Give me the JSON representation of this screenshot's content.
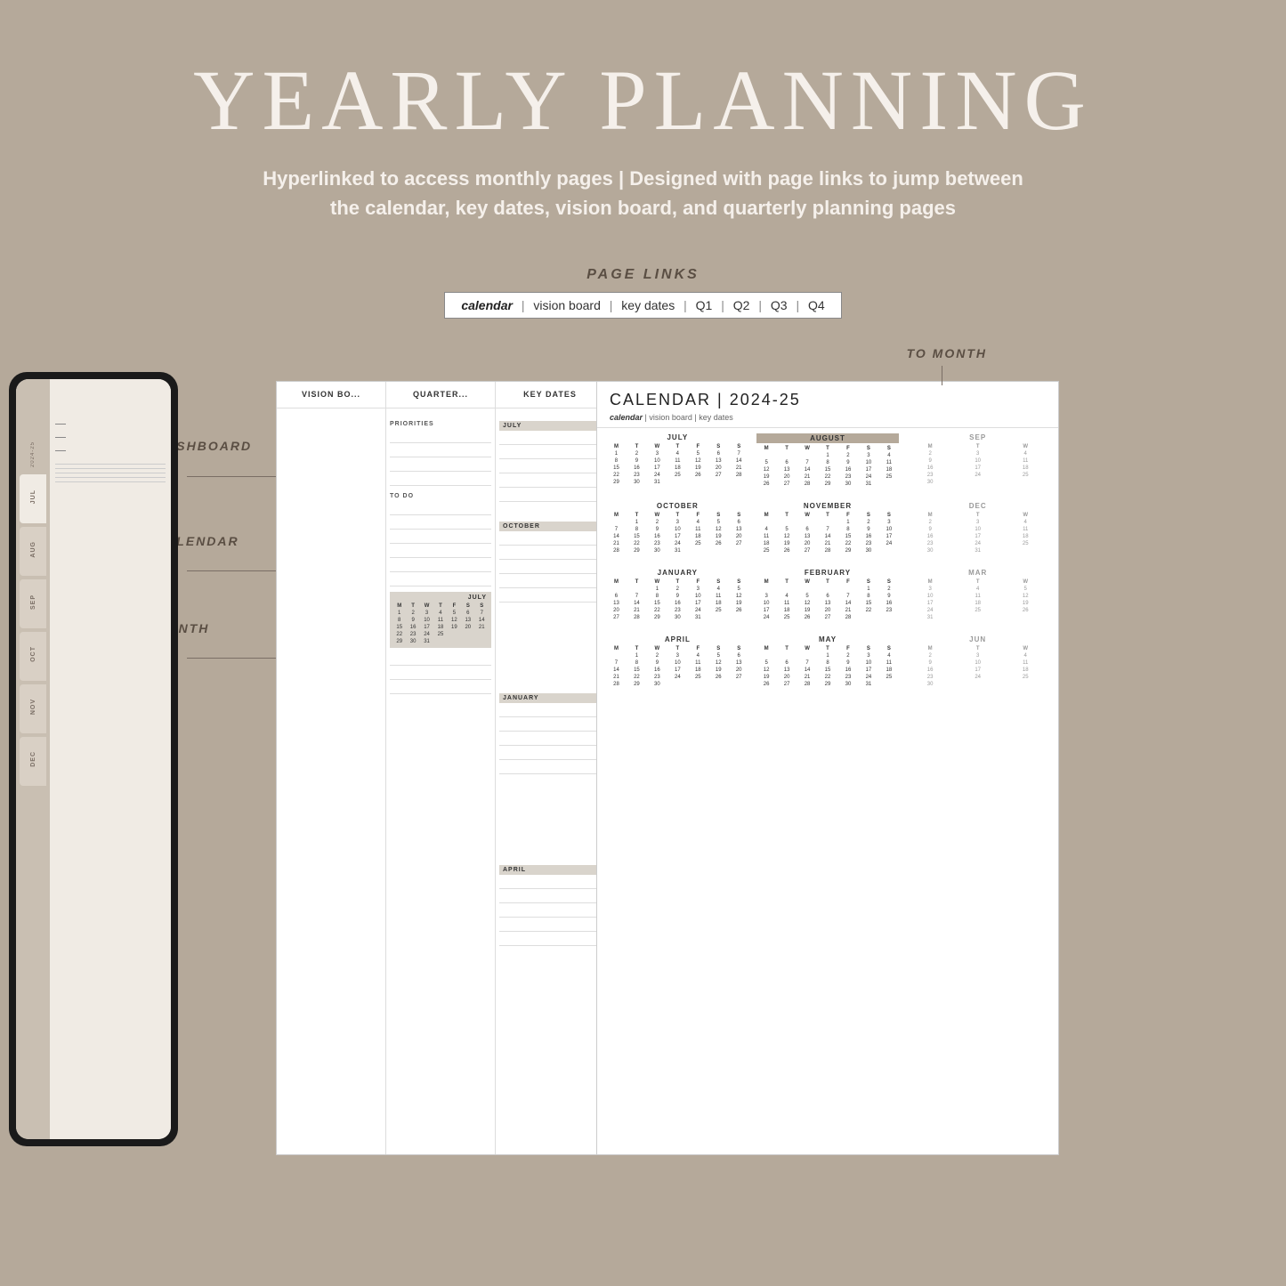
{
  "header": {
    "title": "YEARLY PLANNING",
    "subtitle_line1": "Hyperlinked to access monthly pages | Designed with page links to jump between",
    "subtitle_line2": "the calendar, key dates, vision board, and quarterly planning pages"
  },
  "page_links": {
    "label": "PAGE LINKS",
    "bar_text": "calendar  |  vision board  |  key dates  |  Q1  |  Q2  |  Q3  |  Q4",
    "active": "calendar"
  },
  "labels": {
    "to_dashboard": "TO DASHBOARD",
    "to_calendar": "TO CALENDAR",
    "to_month": "TO MONTH",
    "to_month_top": "TO MONTH"
  },
  "tablet": {
    "year": "2024-25",
    "tabs": [
      "JUL",
      "AUG",
      "SEP",
      "OCT",
      "NOV",
      "DEC"
    ]
  },
  "quarterly_doc": {
    "col1_header": "VISION BO...",
    "col2_header": "QUARTER...",
    "col3_header": "KEY DATES",
    "priorities_label": "PRIORITIES",
    "todo_label": "TO DO",
    "months": [
      "JULY",
      "OCTOBER",
      "JANUARY",
      "APRIL"
    ],
    "mini_cal_july": {
      "title": "JULY",
      "headers": [
        "M",
        "T",
        "W",
        "T",
        "F",
        "S",
        "S"
      ],
      "rows": [
        [
          "1",
          "2",
          "3",
          "4",
          "5",
          "6",
          "7"
        ],
        [
          "8",
          "9",
          "10",
          "11",
          "12",
          "13",
          "14"
        ],
        [
          "15",
          "16",
          "17",
          "18",
          "19",
          "20",
          "21"
        ],
        [
          "22",
          "23",
          "24",
          "25",
          "",
          "",
          ""
        ],
        [
          "29",
          "30",
          "31",
          "",
          "",
          "",
          ""
        ]
      ]
    }
  },
  "calendar_doc": {
    "title": "CALENDAR | 2024-25",
    "nav": "calendar  |  vision board  |  key dates",
    "months": {
      "july": {
        "name": "JULY",
        "headers": [
          "M",
          "T",
          "W",
          "T",
          "F",
          "S",
          "S"
        ],
        "rows": [
          [
            "1",
            "2",
            "3",
            "4",
            "5",
            "6",
            "7"
          ],
          [
            "8",
            "9",
            "10",
            "11",
            "12",
            "13",
            "14"
          ],
          [
            "15",
            "16",
            "17",
            "18",
            "19",
            "20",
            "21"
          ],
          [
            "22",
            "23",
            "24",
            "25",
            "26",
            "27",
            "28"
          ],
          [
            "29",
            "30",
            "31",
            "",
            "",
            "",
            ""
          ]
        ]
      },
      "august": {
        "name": "AUGUST",
        "highlighted": true,
        "headers": [
          "M",
          "T",
          "W",
          "T",
          "F",
          "S",
          "S"
        ],
        "rows": [
          [
            "",
            "",
            "",
            "1",
            "2",
            "3",
            "4"
          ],
          [
            "5",
            "6",
            "7",
            "8",
            "9",
            "10",
            "11"
          ],
          [
            "12",
            "13",
            "14",
            "15",
            "16",
            "17",
            "18"
          ],
          [
            "19",
            "20",
            "21",
            "22",
            "23",
            "24",
            "25"
          ],
          [
            "26",
            "27",
            "28",
            "29",
            "30",
            "31",
            ""
          ]
        ]
      },
      "october": {
        "name": "OCTOBER",
        "headers": [
          "M",
          "T",
          "W",
          "T",
          "F",
          "S",
          "S"
        ],
        "rows": [
          [
            "",
            "1",
            "2",
            "3",
            "4",
            "5",
            "6"
          ],
          [
            "7",
            "8",
            "9",
            "10",
            "11",
            "12",
            "13"
          ],
          [
            "14",
            "15",
            "16",
            "17",
            "18",
            "19",
            "20"
          ],
          [
            "21",
            "22",
            "23",
            "24",
            "25",
            "26",
            "27"
          ],
          [
            "28",
            "29",
            "30",
            "31",
            "",
            "",
            ""
          ]
        ]
      },
      "november": {
        "name": "NOVEMBER",
        "headers": [
          "M",
          "T",
          "W",
          "T",
          "F",
          "S",
          "S"
        ],
        "rows": [
          [
            "",
            "",
            "",
            "",
            "1",
            "2",
            "3"
          ],
          [
            "4",
            "5",
            "6",
            "7",
            "8",
            "9",
            "10"
          ],
          [
            "11",
            "12",
            "13",
            "14",
            "15",
            "16",
            "17"
          ],
          [
            "18",
            "19",
            "20",
            "21",
            "22",
            "23",
            "24"
          ],
          [
            "25",
            "26",
            "27",
            "28",
            "29",
            "30",
            ""
          ]
        ]
      },
      "january": {
        "name": "JANUARY",
        "headers": [
          "M",
          "T",
          "W",
          "T",
          "F",
          "S",
          "S"
        ],
        "rows": [
          [
            "",
            "",
            "1",
            "2",
            "3",
            "4",
            "5"
          ],
          [
            "6",
            "7",
            "8",
            "9",
            "10",
            "11",
            "12"
          ],
          [
            "13",
            "14",
            "15",
            "16",
            "17",
            "18",
            "19"
          ],
          [
            "20",
            "21",
            "22",
            "23",
            "24",
            "25",
            "26"
          ],
          [
            "27",
            "28",
            "29",
            "30",
            "31",
            "",
            ""
          ]
        ]
      },
      "february": {
        "name": "FEBRUARY",
        "headers": [
          "M",
          "T",
          "W",
          "T",
          "F",
          "S",
          "S"
        ],
        "rows": [
          [
            "",
            "",
            "",
            "",
            "",
            "1",
            "2"
          ],
          [
            "3",
            "4",
            "5",
            "6",
            "7",
            "8",
            "9"
          ],
          [
            "10",
            "11",
            "12",
            "13",
            "14",
            "15",
            "16"
          ],
          [
            "17",
            "18",
            "19",
            "20",
            "21",
            "22",
            "23"
          ],
          [
            "24",
            "25",
            "26",
            "27",
            "28",
            "",
            ""
          ]
        ]
      },
      "april": {
        "name": "APRIL",
        "headers": [
          "M",
          "T",
          "W",
          "T",
          "F",
          "S",
          "S"
        ],
        "rows": [
          [
            "",
            "1",
            "2",
            "3",
            "4",
            "5",
            "6"
          ],
          [
            "7",
            "8",
            "9",
            "10",
            "11",
            "12",
            "13"
          ],
          [
            "14",
            "15",
            "16",
            "17",
            "18",
            "19",
            "20"
          ],
          [
            "21",
            "22",
            "23",
            "24",
            "25",
            "26",
            "27"
          ],
          [
            "28",
            "29",
            "30",
            "",
            "",
            "",
            ""
          ]
        ]
      },
      "may": {
        "name": "MAY",
        "headers": [
          "M",
          "T",
          "W",
          "T",
          "F",
          "S",
          "S"
        ],
        "rows": [
          [
            "",
            "",
            "",
            "1",
            "2",
            "3",
            "4"
          ],
          [
            "5",
            "6",
            "7",
            "8",
            "9",
            "10",
            "11"
          ],
          [
            "12",
            "13",
            "14",
            "15",
            "16",
            "17",
            "18"
          ],
          [
            "19",
            "20",
            "21",
            "22",
            "23",
            "24",
            "25"
          ],
          [
            "26",
            "27",
            "28",
            "29",
            "30",
            "31",
            ""
          ]
        ]
      }
    }
  }
}
